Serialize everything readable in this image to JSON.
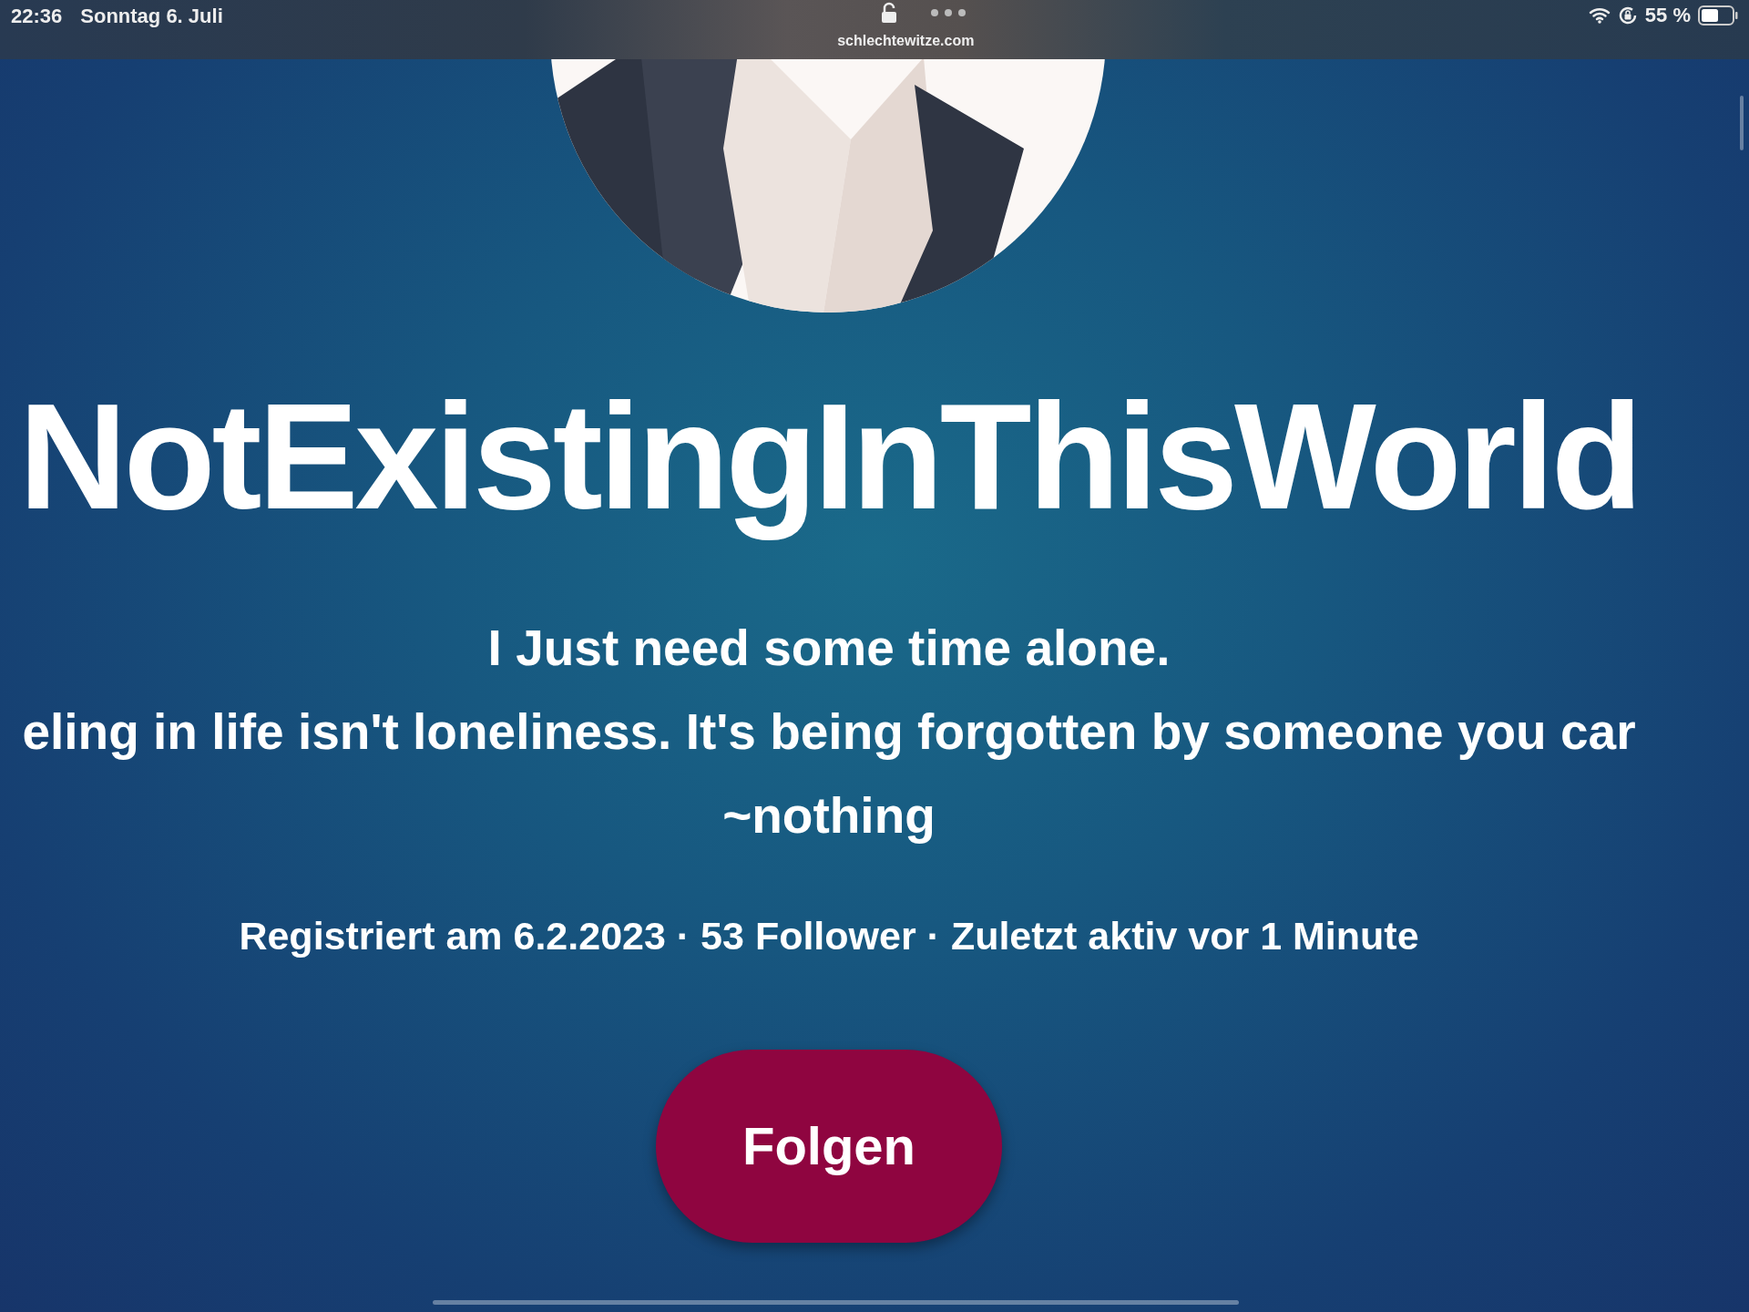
{
  "status_bar": {
    "time": "22:36",
    "date": "Sonntag 6. Juli",
    "url": "schlechtewitze.com",
    "battery": "55 %"
  },
  "profile": {
    "username": "NotExistingInThisWorld",
    "bio": [
      "I Just need some time alone.",
      "eling in life isn't loneliness. It's being forgotten by someone you car",
      "~nothing"
    ],
    "meta": "Registriert am 6.2.2023 · 53 Follower · Zuletzt aktiv vor 1 Minute",
    "follow_button": "Folgen"
  }
}
